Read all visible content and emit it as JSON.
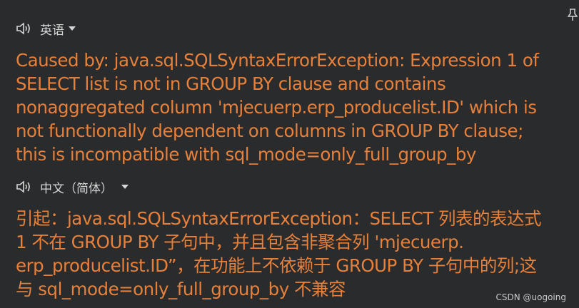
{
  "source": {
    "language_label": "英语",
    "lines": [
      "Caused by: java.sql.SQLSyntaxErrorException: Expression 1 of",
      "SELECT list is not in GROUP BY clause and contains",
      "nonaggregated column 'mjecuerp.erp_producelist.ID' which is",
      "not functionally dependent on columns in GROUP BY clause;",
      "this is incompatible with sql_mode=only_full_group_by"
    ]
  },
  "target": {
    "language_label": "中文（简体）",
    "lines": [
      "引起：java.sql.SQLSyntaxErrorException：SELECT 列表的表达式",
      "1 不在 GROUP BY 子句中，并且包含非聚合列 'mjecuerp.",
      "erp_producelist.ID”，在功能上不依赖于 GROUP BY 子句中的列;这",
      "与 sql_mode=only_full_group_by 不兼容"
    ]
  },
  "watermark": "CSDN @uogoing",
  "colors": {
    "background": "#2a2b2c",
    "text_orange": "#e7803a",
    "label_gray": "#d7d7d7"
  },
  "icons": {
    "speaker": "speaker-icon",
    "dropdown": "caret-down-icon",
    "pin": "pin-icon"
  }
}
